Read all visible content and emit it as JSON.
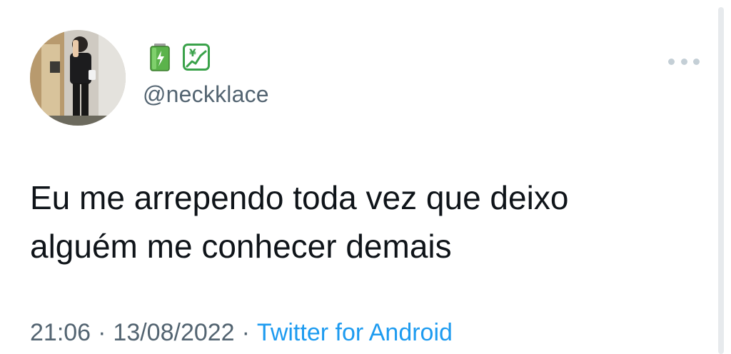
{
  "tweet": {
    "handle": "@neckklace",
    "badges": [
      {
        "icon": "battery-icon",
        "color": "#5bb34b"
      },
      {
        "icon": "yen-chart-icon",
        "color": "#3aa24a"
      }
    ],
    "text_lines": [
      "Eu me arrependo toda vez que deixo",
      "alguém me conhecer demais"
    ],
    "time": "21:06",
    "separator": "·",
    "date": "13/08/2022",
    "source": "Twitter for Android"
  },
  "colors": {
    "text": "#0f1419",
    "muted": "#536471",
    "link": "#1d9bf0"
  }
}
